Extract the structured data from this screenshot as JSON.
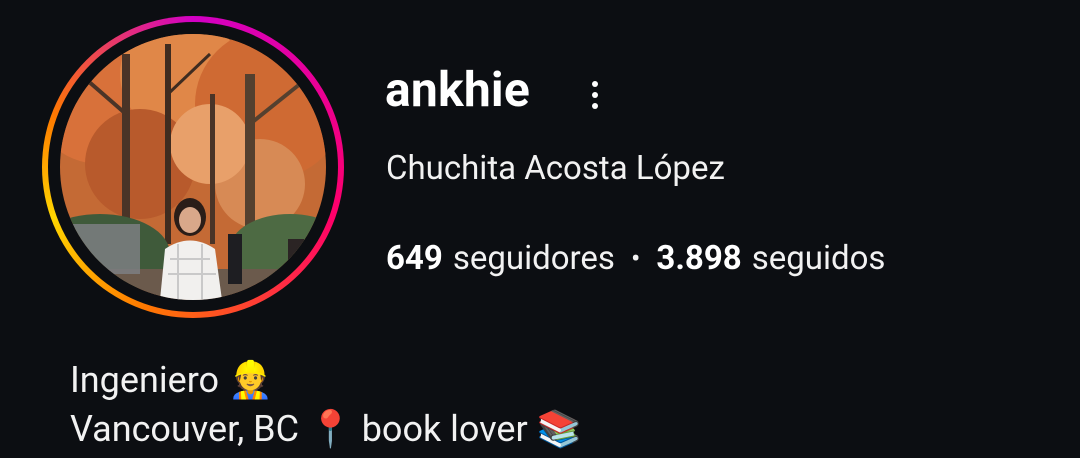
{
  "profile": {
    "username": "ankhie",
    "full_name": "Chuchita Acosta López",
    "avatar_alt": "profile photo",
    "menu_icon": "more-vertical-icon",
    "ring_colors": [
      "#d300c5",
      "#ff0069",
      "#ff7a00",
      "#ffd600"
    ]
  },
  "stats": {
    "followers_count": "649",
    "followers_label": "seguidores",
    "separator": "•",
    "following_count": "3.898",
    "following_label": "seguidos"
  },
  "bio": {
    "line1_text": "Ingeniero",
    "line1_emoji": "👷",
    "line2_text1": "Vancouver, BC",
    "line2_emoji1": "📍",
    "line2_text2": "book lover",
    "line2_emoji2": "📚"
  },
  "colors": {
    "background": "#0c0e12",
    "text": "#f2f2f2"
  }
}
